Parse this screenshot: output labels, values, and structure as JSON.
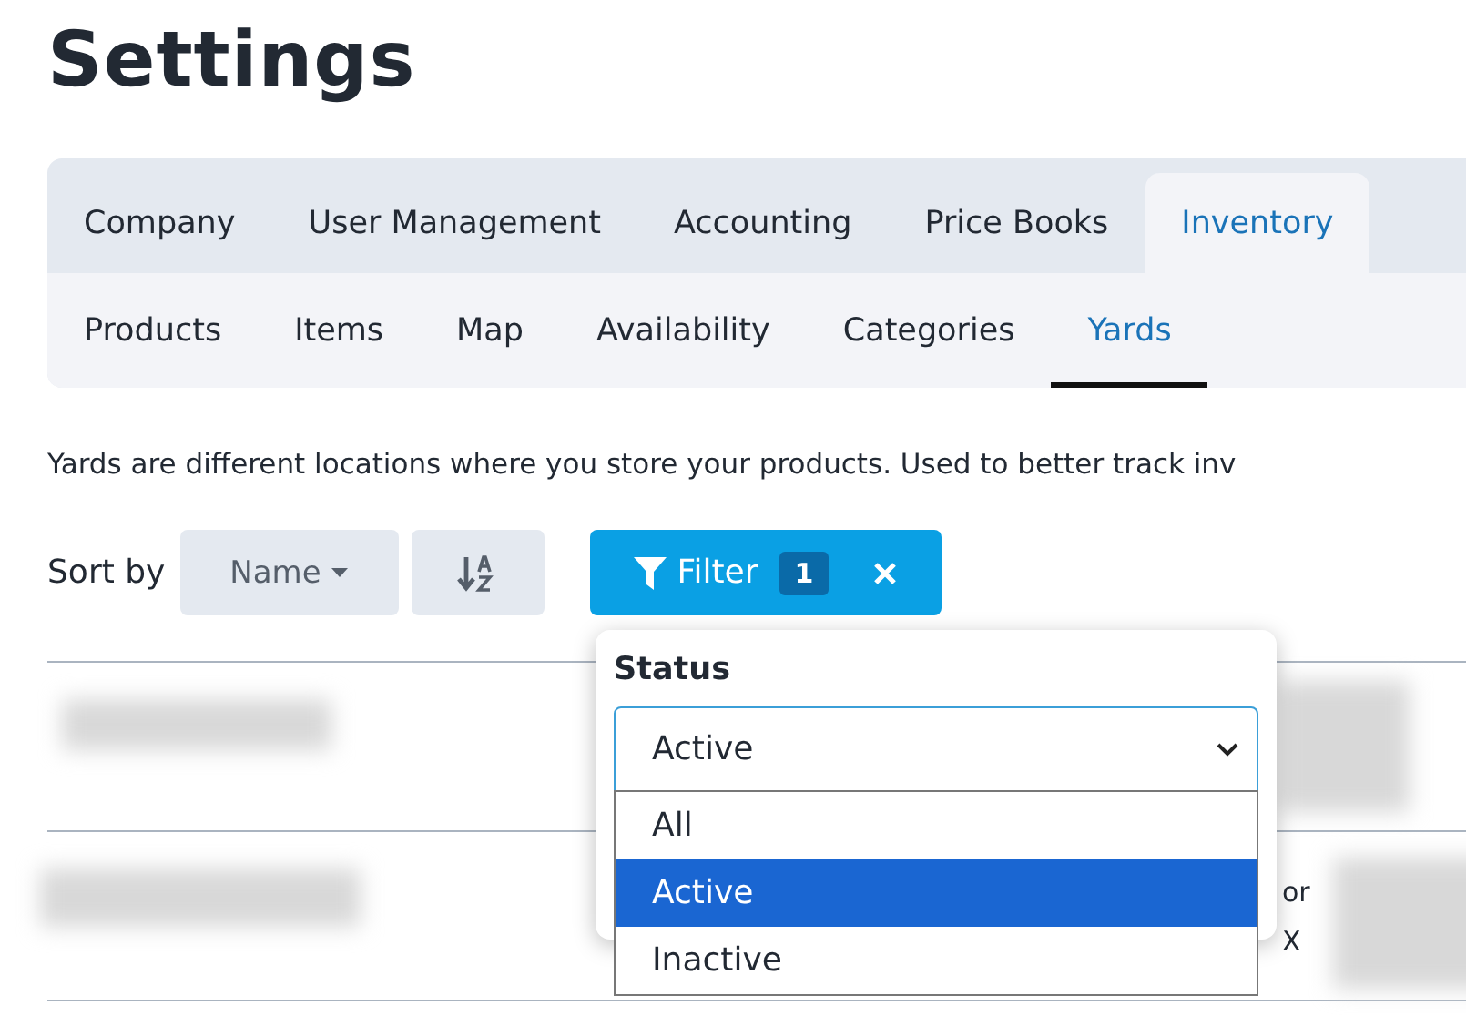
{
  "page": {
    "title": "Settings"
  },
  "tabs": [
    {
      "label": "Company",
      "selected": false
    },
    {
      "label": "User Management",
      "selected": false
    },
    {
      "label": "Accounting",
      "selected": false
    },
    {
      "label": "Price Books",
      "selected": false
    },
    {
      "label": "Inventory",
      "selected": true
    }
  ],
  "subtabs": [
    {
      "label": "Products",
      "selected": false
    },
    {
      "label": "Items",
      "selected": false
    },
    {
      "label": "Map",
      "selected": false
    },
    {
      "label": "Availability",
      "selected": false
    },
    {
      "label": "Categories",
      "selected": false
    },
    {
      "label": "Yards",
      "selected": true
    }
  ],
  "description": "Yards are different locations where you store your products. Used to better track inv",
  "sort": {
    "label": "Sort by",
    "field": "Name"
  },
  "filter": {
    "label": "Filter",
    "count": "1"
  },
  "filter_menu": {
    "label": "Status",
    "value": "Active",
    "options": [
      {
        "label": "All",
        "selected": false
      },
      {
        "label": "Active",
        "selected": true
      },
      {
        "label": "Inactive",
        "selected": false
      }
    ]
  },
  "rows": [
    {
      "kind": "redacted"
    },
    {
      "kind": "redacted",
      "fragment_lines": [
        "or",
        "X"
      ]
    }
  ]
}
